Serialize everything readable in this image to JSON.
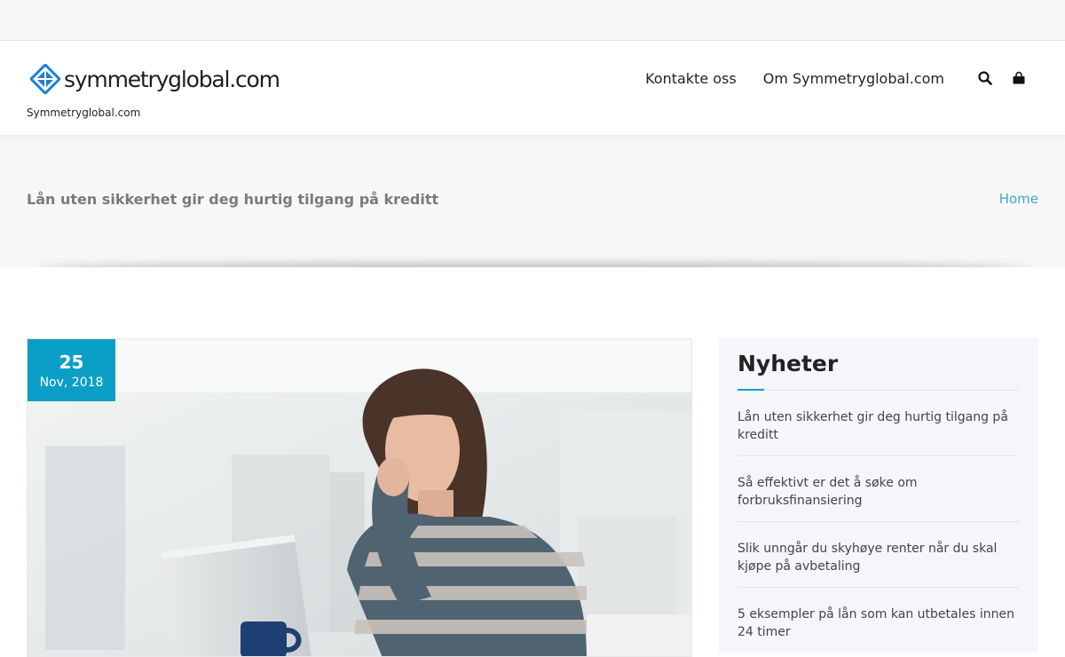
{
  "header": {
    "logo_text": "symmetryglobal.com",
    "tagline": "Symmetryglobal.com",
    "nav": [
      "Kontakte oss",
      "Om Symmetryglobal.com"
    ],
    "search_icon": "search-icon",
    "cart_icon": "shopping-bag-icon"
  },
  "banner": {
    "title": "Lån uten sikkerhet gir deg hurtig tilgang på kreditt",
    "breadcrumb": "Home"
  },
  "post": {
    "day": "25",
    "month_year": "Nov, 2018",
    "image": "woman-with-laptop-photo"
  },
  "sidebar": {
    "title": "Nyheter",
    "items": [
      "Lån uten sikkerhet gir deg hurtig tilgang på kreditt",
      "Så effektivt er det å søke om forbruksfinansiering",
      "Slik unngår du skyhøye renter når du skal kjøpe på avbetaling",
      "5 eksempler på lån som kan utbetales innen 24 timer"
    ]
  },
  "colors": {
    "accent": "#0b9fc8",
    "link": "#3fa8c7",
    "banner_bg": "#f7f7f7",
    "sidebar_bg": "#f4f6f9"
  }
}
